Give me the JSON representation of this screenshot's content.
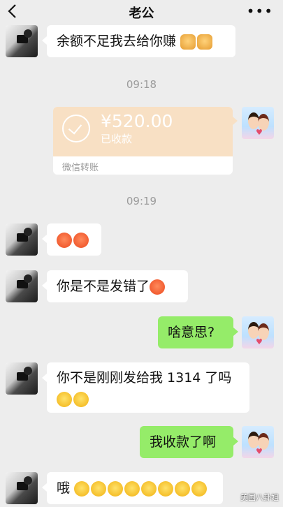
{
  "header": {
    "title": "老公",
    "more": "•••"
  },
  "messages": {
    "m1": "余额不足我去给你赚",
    "time1": "09:18",
    "transfer": {
      "amount": "¥520.00",
      "status": "已收款",
      "label": "微信转账"
    },
    "time2": "09:19",
    "m3": "你是不是发错了",
    "m4": "啥意思?",
    "m5_line1": "你不是刚刚发给我 1314 了吗",
    "m6": "我收款了啊",
    "m7": "哦"
  },
  "icons": {
    "back": "chevron-left-icon",
    "more": "more-dots-icon",
    "angry": "angry-face-emoji",
    "laugh": "laughing-face-emoji",
    "fist": "fist-emoji"
  },
  "watermark": "美国八卦姐",
  "colors": {
    "background": "#ededed",
    "green_bubble": "#95ec69",
    "transfer_card": "#f8e0c4"
  }
}
